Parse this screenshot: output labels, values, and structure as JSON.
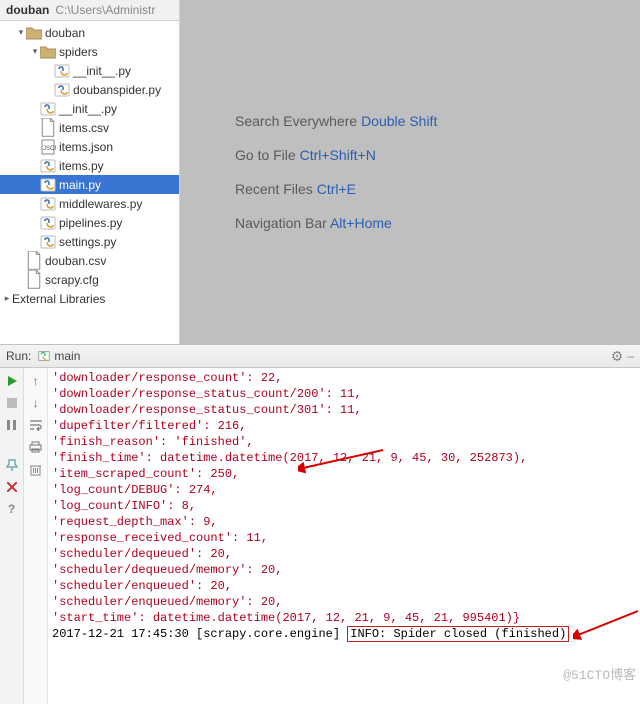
{
  "breadcrumb": {
    "project": "douban",
    "path": "C:\\Users\\Administr"
  },
  "tree": [
    {
      "d": 0,
      "exp": "open",
      "ico": "folder",
      "label": "douban"
    },
    {
      "d": 1,
      "exp": "open",
      "ico": "folder",
      "label": "spiders"
    },
    {
      "d": 2,
      "exp": "",
      "ico": "py",
      "label": "__init__.py"
    },
    {
      "d": 2,
      "exp": "",
      "ico": "py",
      "label": "doubanspider.py"
    },
    {
      "d": 1,
      "exp": "",
      "ico": "py",
      "label": "__init__.py"
    },
    {
      "d": 1,
      "exp": "",
      "ico": "file",
      "label": "items.csv"
    },
    {
      "d": 1,
      "exp": "",
      "ico": "json",
      "label": "items.json"
    },
    {
      "d": 1,
      "exp": "",
      "ico": "py",
      "label": "items.py"
    },
    {
      "d": 1,
      "exp": "",
      "ico": "py",
      "label": "main.py",
      "sel": true
    },
    {
      "d": 1,
      "exp": "",
      "ico": "py",
      "label": "middlewares.py"
    },
    {
      "d": 1,
      "exp": "",
      "ico": "py",
      "label": "pipelines.py"
    },
    {
      "d": 1,
      "exp": "",
      "ico": "py",
      "label": "settings.py"
    },
    {
      "d": 0,
      "exp": "",
      "ico": "file",
      "label": "douban.csv"
    },
    {
      "d": 0,
      "exp": "",
      "ico": "file",
      "label": "scrapy.cfg"
    }
  ],
  "ext_lib": "External Libraries",
  "hints": [
    {
      "t1": "Search Everywhere ",
      "sc": "Double Shift"
    },
    {
      "t1": "Go to File ",
      "sc": "Ctrl+Shift+N"
    },
    {
      "t1": "Recent Files ",
      "sc": "Ctrl+E"
    },
    {
      "t1": "Navigation Bar ",
      "sc": "Alt+Home"
    }
  ],
  "run": {
    "title": "Run:",
    "name": "main"
  },
  "console": [
    "'downloader/response_count': 22,",
    "'downloader/response_status_count/200': 11,",
    "'downloader/response_status_count/301': 11,",
    "'dupefilter/filtered': 216,",
    "'finish_reason': 'finished',",
    "'finish_time': datetime.datetime(2017, 12, 21, 9, 45, 30, 252873),",
    "'item_scraped_count': 250,",
    "'log_count/DEBUG': 274,",
    "'log_count/INFO': 8,",
    "'request_depth_max': 9,",
    "'response_received_count': 11,",
    "'scheduler/dequeued': 20,",
    "'scheduler/dequeued/memory': 20,",
    "'scheduler/enqueued': 20,",
    "'scheduler/enqueued/memory': 20,",
    "'start_time': datetime.datetime(2017, 12, 21, 9, 45, 21, 995401)}"
  ],
  "log_line": {
    "ts": "2017-12-21 17:45:30",
    "src": "[scrapy.core.engine]",
    "msg": "INFO: Spider closed (finished)"
  },
  "watermark": "@51CTO博客"
}
